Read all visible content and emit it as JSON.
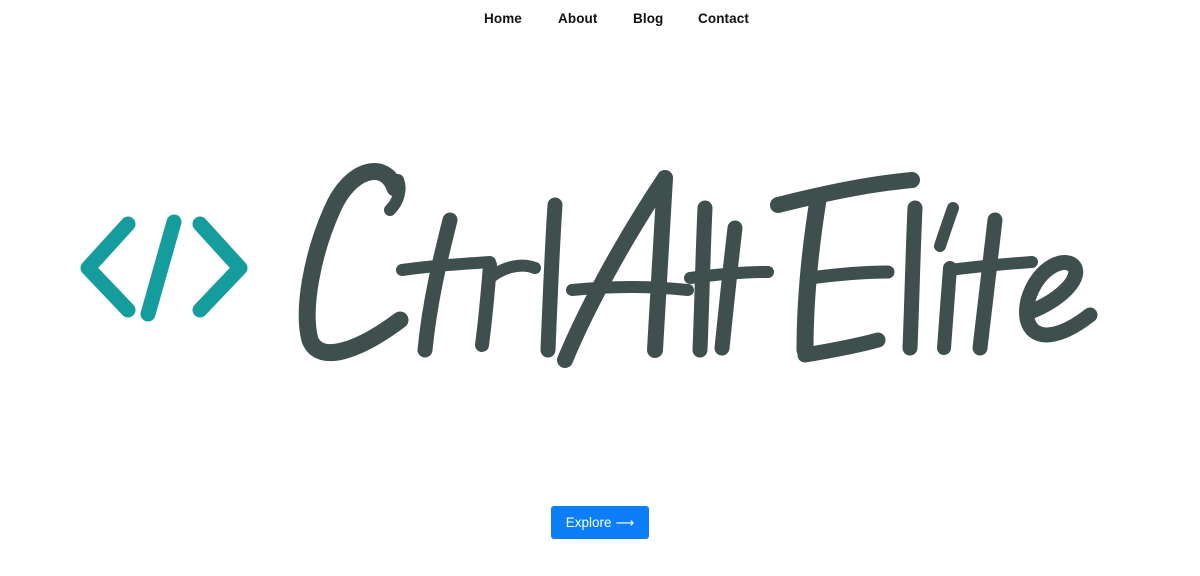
{
  "nav": {
    "items": [
      {
        "label": "Home"
      },
      {
        "label": "About"
      },
      {
        "label": "Blog"
      },
      {
        "label": "Contact"
      }
    ]
  },
  "hero": {
    "logo_text": "CtrlAltElite",
    "icon": "code-brackets-icon",
    "icon_color": "#159c9c",
    "text_color": "#3f4f4d"
  },
  "cta": {
    "label": "Explore",
    "arrow": "⟶",
    "color": "#0d7ef9"
  }
}
